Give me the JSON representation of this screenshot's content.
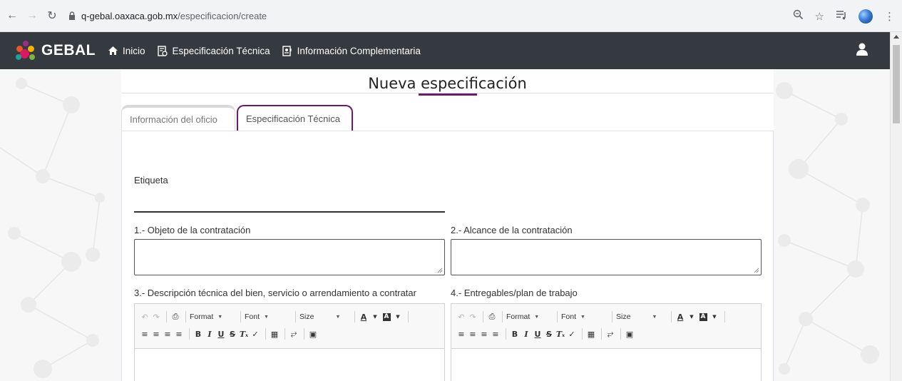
{
  "browser": {
    "url_host": "q-gebal.oaxaca.gob.mx",
    "url_path": "/especificacion/create"
  },
  "navbar": {
    "brand": "GEBAL",
    "items": [
      {
        "label": "Inicio",
        "icon": "home-icon"
      },
      {
        "label": "Especificación Técnica",
        "icon": "document-settings-icon"
      },
      {
        "label": "Información Complementaria",
        "icon": "badge-icon"
      }
    ],
    "user_icon": "user-icon"
  },
  "page": {
    "title": "Nueva especificación",
    "accent_color": "#6a1b6a",
    "tabs": [
      {
        "label": "Información del oficio",
        "active": false
      },
      {
        "label": "Especificación Técnica",
        "active": true
      }
    ]
  },
  "form": {
    "etiqueta_label": "Etiqueta",
    "etiqueta_value": "",
    "field1_label": "1.- Objeto de la contratación",
    "field2_label": "2.- Alcance de la contratación",
    "field3_label": "3.- Descripción técnica del bien, servicio o arrendamiento a contratar",
    "field4_label": "4.- Entregables/plan de trabajo"
  },
  "editor_toolbar": {
    "format_label": "Format",
    "font_label": "Font",
    "size_label": "Size",
    "bold": "B",
    "italic": "I",
    "underline": "U",
    "strike": "S",
    "text_color": "A"
  }
}
